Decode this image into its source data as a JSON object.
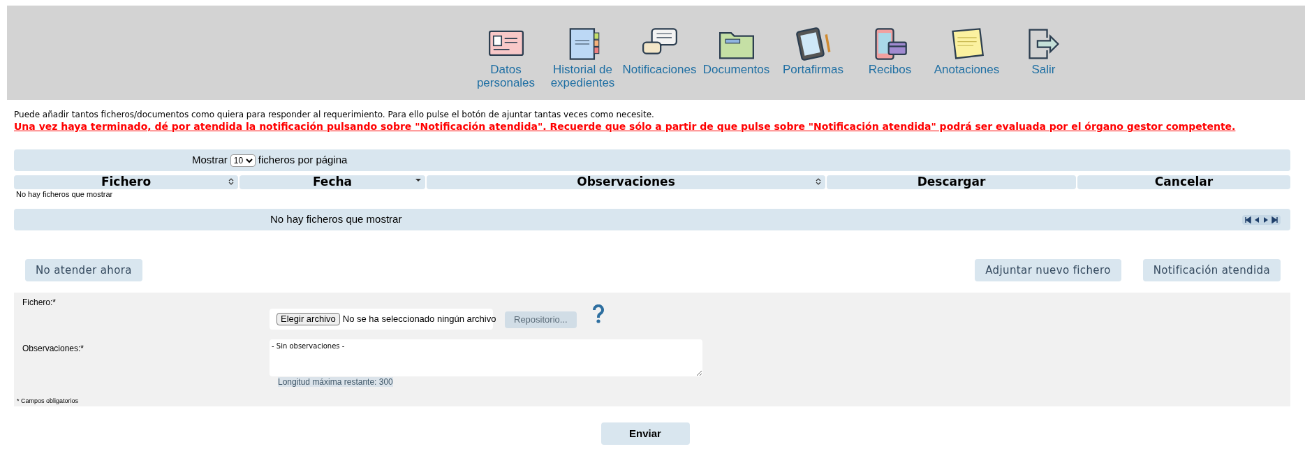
{
  "nav": [
    {
      "kind": "id-card",
      "label": "Datos personales"
    },
    {
      "kind": "binder",
      "label": "Historial de expedientes"
    },
    {
      "kind": "chat",
      "label": "Notificaciones"
    },
    {
      "kind": "folder",
      "label": "Documentos"
    },
    {
      "kind": "tablet",
      "label": "Portafirmas"
    },
    {
      "kind": "receipt",
      "label": "Recibos"
    },
    {
      "kind": "note",
      "label": "Anotaciones"
    },
    {
      "kind": "exit",
      "label": "Salir"
    }
  ],
  "intro": "Puede añadir tantos ficheros/documentos como quiera para responder al requerimiento. Para ello pulse el botón de ajuntar tantas veces como necesite.",
  "warning": "Una vez haya terminado, dé por atendida la notificación pulsando sobre \"Notificación atendida\". Recuerde que sólo a partir de que pulse sobre \"Notificación atendida\" podrá ser evaluada por el órgano gestor competente.",
  "table": {
    "show_prefix": "Mostrar",
    "page_size": "10",
    "show_suffix": "ficheros por página",
    "columns": [
      {
        "label": "Fichero",
        "kind": "sortable"
      },
      {
        "label": "Fecha",
        "kind": "sorted-descending"
      },
      {
        "label": "Observaciones",
        "kind": "sortable"
      },
      {
        "label": "Descargar",
        "kind": "plain"
      },
      {
        "label": "Cancelar",
        "kind": "plain"
      }
    ],
    "empty": "No hay ficheros que mostrar",
    "footer_info": "No hay ficheros que mostrar"
  },
  "buttons": {
    "later": "No atender ahora",
    "attach": "Adjuntar nuevo fichero",
    "done": "Notificación atendida"
  },
  "form": {
    "file_label": "Fichero:*",
    "choose": "Elegir archivo",
    "no_file": "No se ha seleccionado ningún archivo",
    "repo": "Repositorio...",
    "obs_label": "Observaciones:*",
    "obs_value": "- Sin observaciones -",
    "remaining": "Longitud máxima restante: 300",
    "required_note": "* Campos obligatorios"
  },
  "submit": "Enviar"
}
